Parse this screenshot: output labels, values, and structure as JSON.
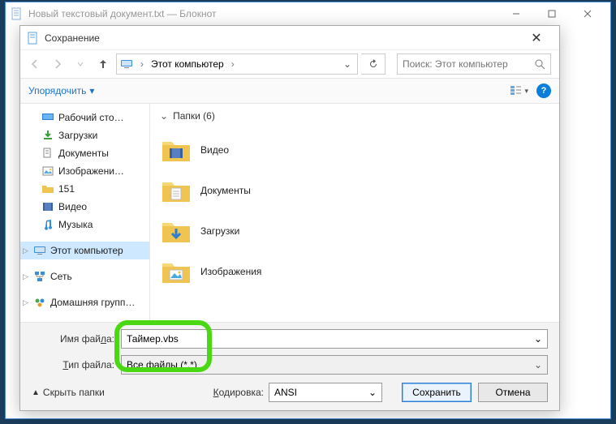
{
  "notepad": {
    "title": "Новый текстовый документ.txt — Блокнот"
  },
  "dialog": {
    "title": "Сохранение",
    "address": {
      "location": "Этот компьютер"
    },
    "search": {
      "placeholder": "Поиск: Этот компьютер"
    },
    "toolbar": {
      "organize": "Упорядочить"
    },
    "sidebar": {
      "items": [
        {
          "label": "Рабочий сто…",
          "icon": "desktop"
        },
        {
          "label": "Загрузки",
          "icon": "downloads"
        },
        {
          "label": "Документы",
          "icon": "documents"
        },
        {
          "label": "Изображени…",
          "icon": "pictures"
        },
        {
          "label": "151",
          "icon": "folder"
        },
        {
          "label": "Видео",
          "icon": "videos"
        },
        {
          "label": "Музыка",
          "icon": "music"
        }
      ],
      "this_pc": "Этот компьютер",
      "network": "Сеть",
      "homegroup": "Домашняя групп…"
    },
    "content": {
      "group_label": "Папки (6)",
      "folders": [
        {
          "label": "Видео",
          "icon": "videos"
        },
        {
          "label": "Документы",
          "icon": "documents"
        },
        {
          "label": "Загрузки",
          "icon": "downloads"
        },
        {
          "label": "Изображения",
          "icon": "pictures"
        }
      ]
    },
    "filename_label_pre": "Имя фай",
    "filename_label_u": "л",
    "filename_label_post": "а:",
    "filetype_label_u": "Т",
    "filetype_label_post": "ип файла:",
    "filename_value": "Таймер.vbs",
    "filetype_value": "Все файлы  (*.*)",
    "hide_folders": "Скрыть папки",
    "encoding_label_u": "К",
    "encoding_label_post": "одировка:",
    "encoding_value": "ANSI",
    "save_button": "Сохранить",
    "cancel_button": "Отмена"
  }
}
